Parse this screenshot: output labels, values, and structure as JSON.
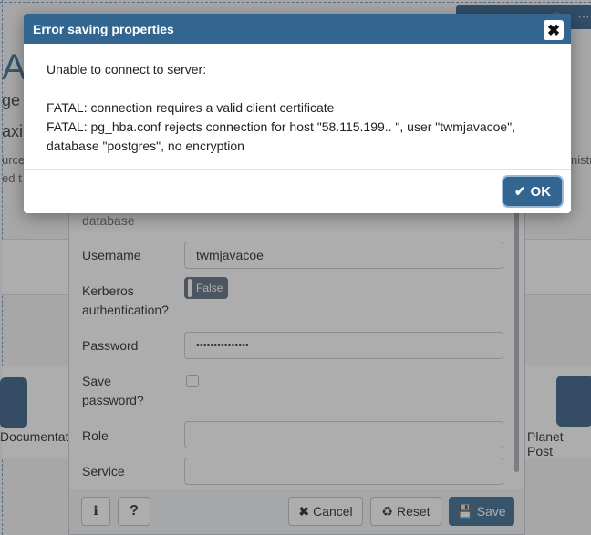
{
  "background": {
    "big_heading": "A",
    "line1": "ge",
    "line2": "axi",
    "snippet_left1": "urce",
    "snippet_left2": "ed t",
    "snippet_right": "nistr",
    "doc_label": "Documentati",
    "planet_label": "Planet Post"
  },
  "properties_dialog": {
    "partial_label": "database",
    "username_label": "Username",
    "username_value": "twmjavacoe",
    "kerberos_label": "Kerberos authentication?",
    "kerberos_value": "False",
    "password_label": "Password",
    "password_value": "•••••••••••••••",
    "save_password_label": "Save password?",
    "role_label": "Role",
    "service_label": "Service",
    "buttons": {
      "info": "i",
      "help": "?",
      "cancel": "Cancel",
      "reset": "Reset",
      "save": "Save"
    }
  },
  "error_modal": {
    "title": "Error saving properties",
    "line1": "Unable to connect to server:",
    "line2": "FATAL: connection requires a valid client certificate",
    "line3": "FATAL: pg_hba.conf rejects connection for host \"58.115.199..    \", user \"twmjavacoe\",",
    "line4": "database \"postgres\", no encryption",
    "ok_label": "OK"
  },
  "icons": {
    "close": "close-icon",
    "ok": "check-icon",
    "cancel": "x-icon",
    "reset": "recycle-icon",
    "save": "floppy-icon"
  },
  "colors": {
    "accent": "#326690",
    "overlay": "rgba(60,60,60,0.42)"
  }
}
